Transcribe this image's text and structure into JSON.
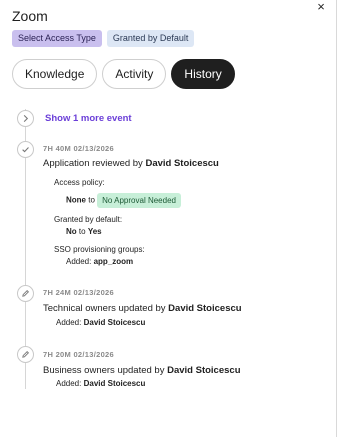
{
  "header": {
    "app_title": "Zoom",
    "close_label": "×",
    "badges": [
      "Select Access Type",
      "Granted by Default"
    ]
  },
  "tabs": [
    {
      "label": "Knowledge",
      "active": false
    },
    {
      "label": "Activity",
      "active": false
    },
    {
      "label": "History",
      "active": true
    }
  ],
  "timeline": {
    "show_more_label": "Show 1 more event",
    "events": [
      {
        "time": "7H 40M 02/13/2026",
        "title_prefix": "Application reviewed by",
        "actor": "David Stoicescu",
        "access_policy_label": "Access policy:",
        "access_policy_from": "None",
        "access_policy_to_word": "to",
        "access_policy_to": "No Approval Needed",
        "granted_label": "Granted by default:",
        "granted_from": "No",
        "granted_to_word": "to",
        "granted_to": "Yes",
        "sso_label": "SSO provisioning groups:",
        "sso_added_label": "Added:",
        "sso_added_value": "app_zoom"
      },
      {
        "time": "7H 24M 02/13/2026",
        "title_prefix": "Technical owners updated by",
        "actor": "David Stoicescu",
        "added_label": "Added:",
        "added_value": "David Stoicescu"
      },
      {
        "time": "7H 20M 02/13/2026",
        "title_prefix": "Business owners updated by",
        "actor": "David Stoicescu",
        "added_label": "Added:",
        "added_value": "David Stoicescu"
      }
    ]
  },
  "colors": {
    "accent_purple": "#6b3fd8",
    "badge_purple": "#c9bfee",
    "badge_blue": "#dde7f5",
    "pill_green": "#c7efd8",
    "active_tab": "#1f1f1f"
  },
  "icons": [
    "close-icon",
    "chevron-right-icon",
    "check-icon",
    "pencil-icon"
  ]
}
